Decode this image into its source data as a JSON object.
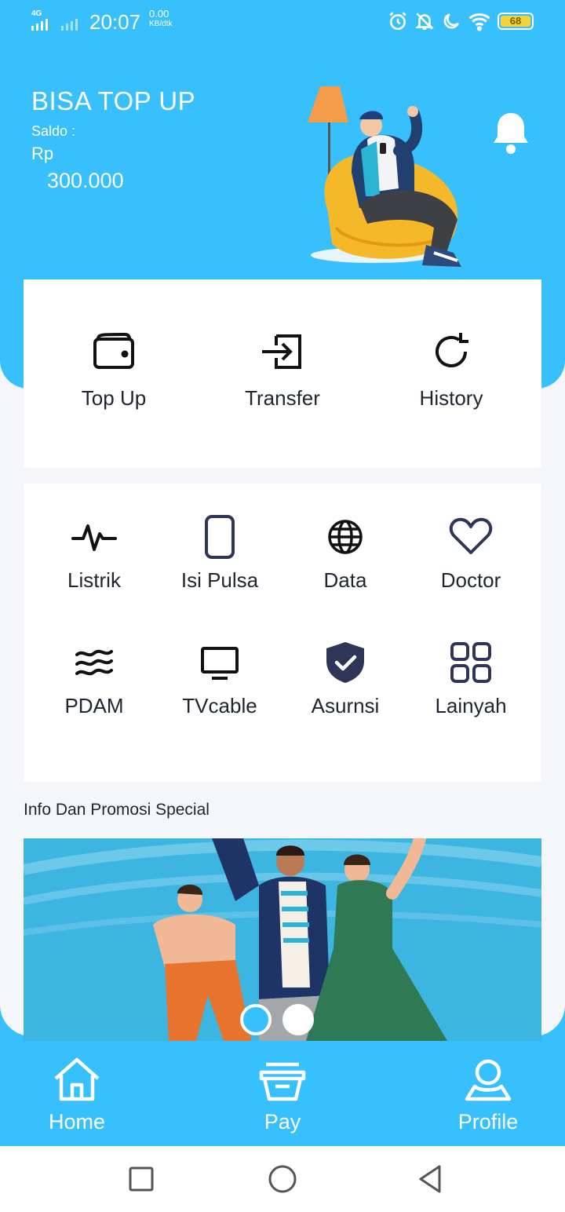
{
  "status_bar": {
    "network": "4G",
    "time": "20:07",
    "speed_value": "0.00",
    "speed_unit": "KB/dtk",
    "battery": "68",
    "icons": [
      "alarm-icon",
      "mute-icon",
      "moon-icon",
      "wifi-icon",
      "battery-icon"
    ]
  },
  "header": {
    "title": "BISA TOP UP",
    "saldo_label": "Saldo :",
    "currency": "Rp",
    "amount": "300.000"
  },
  "quick_actions": [
    {
      "label": "Top Up",
      "icon": "wallet-icon"
    },
    {
      "label": "Transfer",
      "icon": "transfer-icon"
    },
    {
      "label": "History",
      "icon": "history-icon"
    }
  ],
  "services": [
    {
      "label": "Listrik",
      "icon": "pulse-icon"
    },
    {
      "label": "Isi Pulsa",
      "icon": "phone-icon"
    },
    {
      "label": "Data",
      "icon": "globe-icon"
    },
    {
      "label": "Doctor",
      "icon": "heart-icon"
    },
    {
      "label": "PDAM",
      "icon": "waves-icon"
    },
    {
      "label": "TVcable",
      "icon": "tv-icon"
    },
    {
      "label": "Asurnsi",
      "icon": "shield-icon"
    },
    {
      "label": "Lainyah",
      "icon": "grid-icon"
    }
  ],
  "promo": {
    "title": "Info Dan Promosi Special",
    "slides": 2,
    "active_slide": 1
  },
  "bottom_nav": [
    {
      "label": "Home",
      "icon": "home-icon"
    },
    {
      "label": "Pay",
      "icon": "pay-icon"
    },
    {
      "label": "Profile",
      "icon": "profile-icon"
    }
  ],
  "colors": {
    "primary": "#37c0fb",
    "text": "#1e2530",
    "icon_dark": "#2f3556",
    "background": "#f4f6f9"
  }
}
